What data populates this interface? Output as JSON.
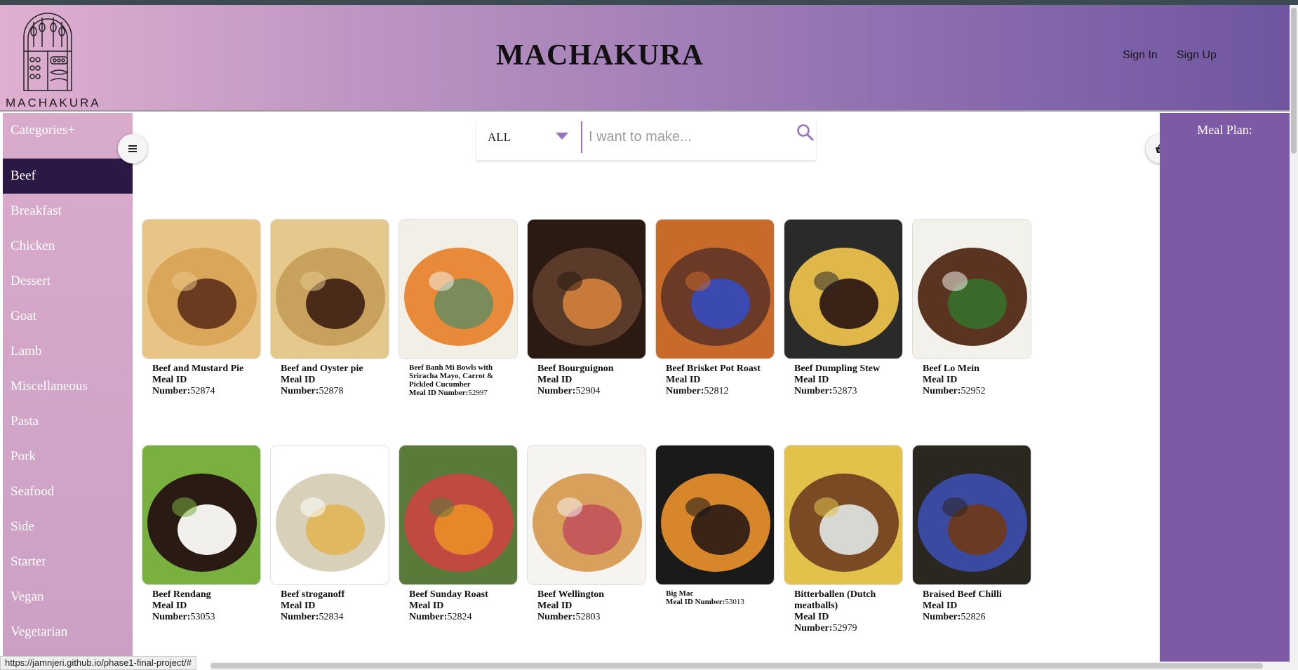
{
  "header": {
    "logo_text": "MACHAKURA",
    "site_title": "MACHAKURA",
    "sign_in": "Sign In",
    "sign_up": "Sign Up"
  },
  "sidebar": {
    "heading": "Categories+",
    "items": [
      {
        "label": "Beef",
        "active": true
      },
      {
        "label": "Breakfast"
      },
      {
        "label": "Chicken"
      },
      {
        "label": "Dessert"
      },
      {
        "label": "Goat"
      },
      {
        "label": "Lamb"
      },
      {
        "label": "Miscellaneous"
      },
      {
        "label": "Pasta"
      },
      {
        "label": "Pork"
      },
      {
        "label": "Seafood"
      },
      {
        "label": "Side"
      },
      {
        "label": "Starter"
      },
      {
        "label": "Vegan"
      },
      {
        "label": "Vegetarian"
      }
    ]
  },
  "search": {
    "filter_value": "ALL",
    "placeholder": "I want to make..."
  },
  "meal_plan": {
    "title": "Meal Plan:"
  },
  "meal_id_label": "Meal ID",
  "meal_number_label": "Number:",
  "meal_id_number_label": "Meal ID Number:",
  "meals": [
    {
      "name": "Beef and Mustard Pie",
      "id": "52874",
      "colors": [
        "#d9a65a",
        "#6b3b1f",
        "#e8c486"
      ]
    },
    {
      "name": "Beef and Oyster pie",
      "id": "52878",
      "colors": [
        "#c8a25c",
        "#4a2a18",
        "#e5c98c"
      ]
    },
    {
      "name": "Beef Banh Mi Bowls with Sriracha Mayo, Carrot & Pickled Cucumber",
      "id": "52997",
      "colors": [
        "#e88a3a",
        "#7a8c5a",
        "#f2efe6"
      ],
      "small": true
    },
    {
      "name": "Beef Bourguignon",
      "id": "52904",
      "colors": [
        "#5a3a28",
        "#c87a3a",
        "#2a1a12"
      ]
    },
    {
      "name": "Beef Brisket Pot Roast",
      "id": "52812",
      "colors": [
        "#6a3a26",
        "#3a4ab0",
        "#c76a2a"
      ]
    },
    {
      "name": "Beef Dumpling Stew",
      "id": "52873",
      "colors": [
        "#e0b84a",
        "#3a2216",
        "#2a2a2a"
      ]
    },
    {
      "name": "Beef Lo Mein",
      "id": "52952",
      "colors": [
        "#5a3420",
        "#3a6a2a",
        "#f3f1ec"
      ]
    },
    {
      "name": "Beef Rendang",
      "id": "53053",
      "colors": [
        "#2a1a14",
        "#f2f0ec",
        "#7ab040"
      ]
    },
    {
      "name": "Beef stroganoff",
      "id": "52834",
      "colors": [
        "#d8d0b8",
        "#e0b860",
        "#ffffff"
      ]
    },
    {
      "name": "Beef Sunday Roast",
      "id": "52824",
      "colors": [
        "#c04a40",
        "#e8862a",
        "#5a7a3a"
      ]
    },
    {
      "name": "Beef Wellington",
      "id": "52803",
      "colors": [
        "#d8a05a",
        "#c45a5a",
        "#f6f4f0"
      ]
    },
    {
      "name": "Big Mac",
      "id": "53013",
      "colors": [
        "#d8862a",
        "#3a2418",
        "#1a1a1a"
      ],
      "small": true
    },
    {
      "name": "Bitterballen (Dutch meatballs)",
      "id": "52979",
      "colors": [
        "#7a4a24",
        "#d8d8d2",
        "#e2c24a"
      ]
    },
    {
      "name": "Braised Beef Chilli",
      "id": "52826",
      "colors": [
        "#3a4aa0",
        "#6a3a22",
        "#2a2620"
      ]
    }
  ],
  "status_url": "https://jamnjeri.github.io/phase1-final-project/#",
  "icons": {
    "menu": "menu-icon",
    "basket": "basket-icon",
    "search": "search-icon",
    "dropdown": "chevron-down-icon"
  }
}
